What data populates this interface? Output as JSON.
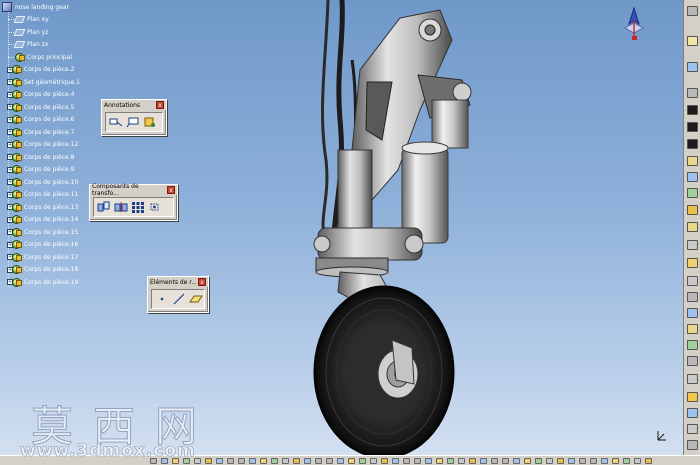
{
  "tree": {
    "items": [
      {
        "label": "nose landing gear",
        "kind": "root"
      },
      {
        "label": "Plan xy",
        "kind": "plane"
      },
      {
        "label": "Plan yz",
        "kind": "plane"
      },
      {
        "label": "Plan zx",
        "kind": "plane"
      },
      {
        "label": "Corps principal",
        "kind": "body"
      },
      {
        "label": "Corps de pièce.2",
        "kind": "body"
      },
      {
        "label": "Set géométrique.1",
        "kind": "body"
      },
      {
        "label": "Corps de pièce.4",
        "kind": "body"
      },
      {
        "label": "Corps de pièce.5",
        "kind": "body"
      },
      {
        "label": "Corps de pièce.6",
        "kind": "body"
      },
      {
        "label": "Corps de pièce.7",
        "kind": "body"
      },
      {
        "label": "Corps de pièce.12",
        "kind": "body"
      },
      {
        "label": "Corps de pièce.8",
        "kind": "body"
      },
      {
        "label": "Corps de pièce.9",
        "kind": "body"
      },
      {
        "label": "Corps de pièce.10",
        "kind": "body"
      },
      {
        "label": "Corps de pièce.11",
        "kind": "body"
      },
      {
        "label": "Corps de pièce.13",
        "kind": "body"
      },
      {
        "label": "Corps de pièce.14",
        "kind": "body"
      },
      {
        "label": "Corps de pièce.15",
        "kind": "body"
      },
      {
        "label": "Corps de pièce.16",
        "kind": "body"
      },
      {
        "label": "Corps de pièce.17",
        "kind": "body"
      },
      {
        "label": "Corps de pièce.18",
        "kind": "body"
      },
      {
        "label": "Corps de pièce.19",
        "kind": "body"
      }
    ]
  },
  "toolbars": {
    "annotations": {
      "title": "Annotations",
      "close": "x",
      "icons": [
        "text-with-leader-icon",
        "callout-icon",
        "flag-note-icon"
      ]
    },
    "transform": {
      "title": "Composants de transfo...",
      "close": "x",
      "icons": [
        "translation-icon",
        "symmetry-icon",
        "pattern-icon",
        "scaling-icon"
      ]
    },
    "reference": {
      "title": "Eléments de r...",
      "close": "x",
      "icons": [
        "point-icon",
        "line-icon",
        "plane-icon"
      ]
    }
  },
  "compass": {
    "icon": "compass-icon"
  },
  "axis_icon": {
    "icon": "xyz-axis-icon"
  },
  "watermark": {
    "brand": "莫西网",
    "url": "www.3dmox.com"
  },
  "colors": {
    "background_top": "#6f98c9",
    "background_bottom": "#d6e2f1",
    "part_metal": "#c9c9c9",
    "tire": "#1b1b1b",
    "toolbar": "#d4d0c8"
  }
}
